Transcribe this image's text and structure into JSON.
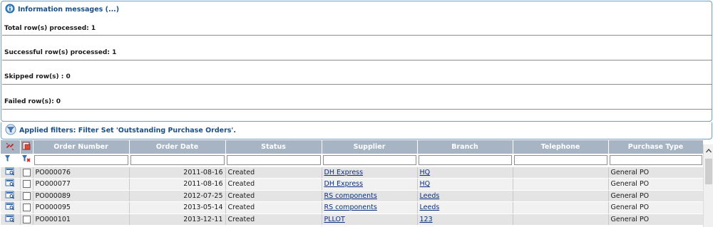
{
  "info": {
    "title": "Information messages (...)",
    "rows": [
      "Total row(s) processed: 1",
      "Successful row(s) processed: 1",
      "Skipped row(s) : 0",
      "Failed row(s): 0"
    ]
  },
  "filters": {
    "title": "Applied filters: Filter Set 'Outstanding Purchase Orders'."
  },
  "grid": {
    "columns": [
      "Order Number",
      "Order Date",
      "Status",
      "Supplier",
      "Branch",
      "Telephone",
      "Purchase Type"
    ],
    "filter_values": [
      "",
      "",
      "",
      "",
      "",
      "",
      ""
    ],
    "rows": [
      {
        "order_number": "PO000076",
        "order_date": "2011-08-16",
        "status": "Created",
        "supplier": "DH Express",
        "branch": "HQ",
        "telephone": "",
        "purchase_type": "General PO"
      },
      {
        "order_number": "PO000077",
        "order_date": "2011-08-16",
        "status": "Created",
        "supplier": "DH Express",
        "branch": "HQ",
        "telephone": "",
        "purchase_type": "General PO"
      },
      {
        "order_number": "PO000089",
        "order_date": "2012-07-25",
        "status": "Created",
        "supplier": "RS components",
        "branch": "Leeds",
        "telephone": "",
        "purchase_type": "General PO"
      },
      {
        "order_number": "PO000095",
        "order_date": "2013-05-14",
        "status": "Created",
        "supplier": "RS components",
        "branch": "Leeds",
        "telephone": "",
        "purchase_type": "General PO"
      },
      {
        "order_number": "PO000101",
        "order_date": "2013-12-11",
        "status": "Created",
        "supplier": "PLLOT",
        "branch": "123",
        "telephone": "",
        "purchase_type": "General PO"
      }
    ]
  },
  "colors": {
    "header_bg": "#a7b4c4",
    "panel_border": "#6f9fc4",
    "title_text": "#1a4f86",
    "link": "#0b2f7e"
  }
}
